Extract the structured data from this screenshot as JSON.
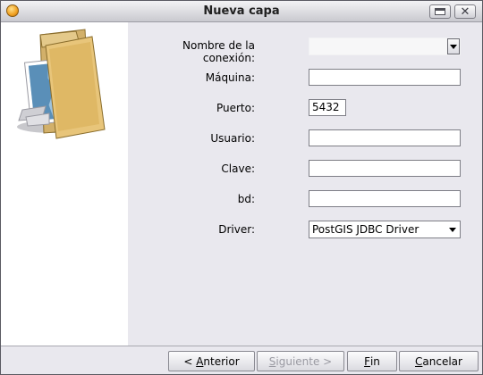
{
  "window": {
    "title": "Nueva capa",
    "icons": {
      "app": "app-sphere-icon",
      "minimize": "minimize-icon",
      "close": "close-icon"
    }
  },
  "illustration": {
    "icon": "folder-with-map-icon"
  },
  "form": {
    "connection_name": {
      "label": "Nombre de la conexión:",
      "value": ""
    },
    "host": {
      "label": "Máquina:",
      "value": ""
    },
    "port": {
      "label": "Puerto:",
      "value": "5432"
    },
    "user": {
      "label": "Usuario:",
      "value": ""
    },
    "password": {
      "label": "Clave:",
      "value": ""
    },
    "database": {
      "label": "bd:",
      "value": ""
    },
    "driver": {
      "label": "Driver:",
      "value": "PostGIS JDBC Driver"
    }
  },
  "footer": {
    "back": {
      "prefix": "< ",
      "mnemonic": "A",
      "rest": "nterior"
    },
    "next": {
      "prefix": "",
      "mnemonic": "S",
      "rest": "iguiente >"
    },
    "finish": {
      "prefix": "",
      "mnemonic": "F",
      "rest": "in"
    },
    "cancel": {
      "prefix": "",
      "mnemonic": "C",
      "rest": "ancelar"
    }
  },
  "colors": {
    "panel": "#e9e8ee",
    "sidebar": "#ffffff",
    "disabled_text": "#9a9aa2"
  }
}
